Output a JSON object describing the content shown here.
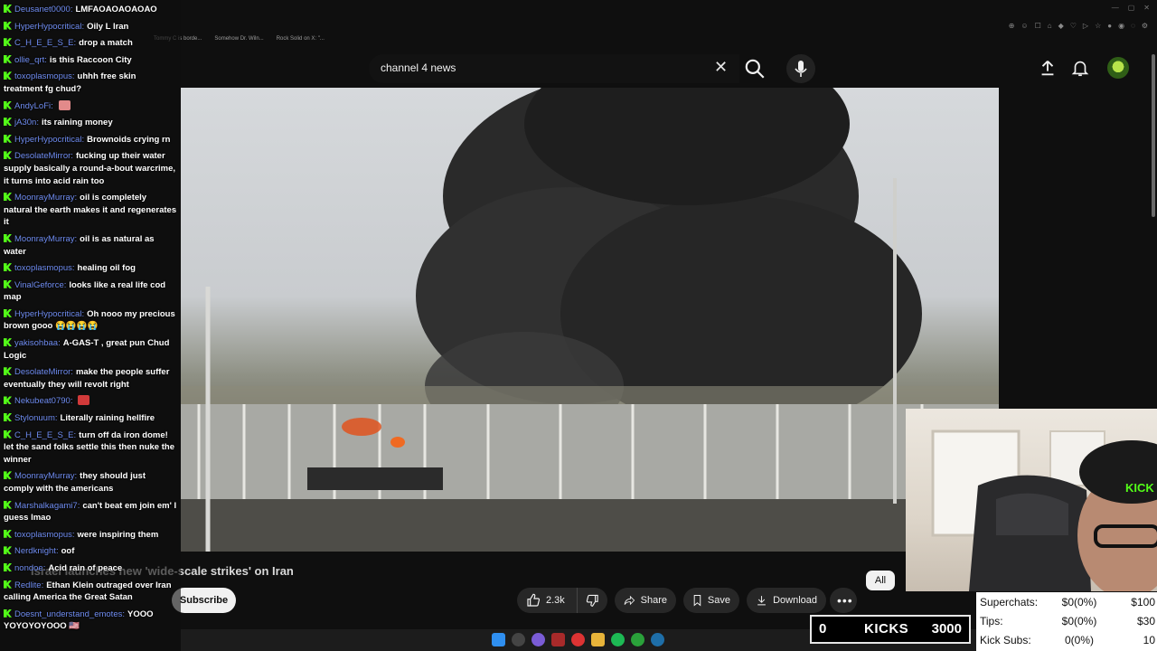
{
  "browser": {
    "tabs": [
      "Tommy C is borde...",
      "Somehow Dr. Wiln...",
      "Rock Solid on X: \"..."
    ]
  },
  "search": {
    "query": "channel 4 news"
  },
  "video": {
    "title": "Israel launches new 'wide-scale strikes' on Iran",
    "filter_chip": "All",
    "subscribe_label": "Subscribe",
    "likes": "2.3k",
    "share_label": "Share",
    "save_label": "Save",
    "download_label": "Download"
  },
  "chat": [
    {
      "user": "Deusanet0000",
      "text": "LMFAOAOAOAOAO"
    },
    {
      "user": "HyperHypocritical",
      "text": "Oily L Iran"
    },
    {
      "user": "C_H_E_E_S_E",
      "text": "drop a match"
    },
    {
      "user": "ollie_qrt",
      "text": "is this Raccoon City"
    },
    {
      "user": "toxoplasmopus",
      "text": "uhhh free skin treatment fg chud?"
    },
    {
      "user": "AndyLoFi",
      "text": "",
      "emote": "pink"
    },
    {
      "user": "jA30n",
      "text": "its raining money"
    },
    {
      "user": "HyperHypocritical",
      "text": "Brownoids crying rn"
    },
    {
      "user": "DesolateMirror",
      "text": "fucking up their water supply basically a round-a-bout warcrime, it turns into acid rain too"
    },
    {
      "user": "MoonrayMurray",
      "text": "oil is completely natural the earth makes it and regenerates it"
    },
    {
      "user": "MoonrayMurray",
      "text": "oil is as natural as water"
    },
    {
      "user": "toxoplasmopus",
      "text": "healing oil fog"
    },
    {
      "user": "VinalGeforce",
      "text": "looks like a real life cod map"
    },
    {
      "user": "HyperHypocritical",
      "text": "Oh nooo my precious brown gooo 😭😭😭😭"
    },
    {
      "user": "yakisohbaa",
      "text": "A-GAS-T , great pun Chud Logic"
    },
    {
      "user": "DesolateMirror",
      "text": "make the people suffer eventually they will revolt right"
    },
    {
      "user": "Nekubeat0790",
      "text": "",
      "emote": "red"
    },
    {
      "user": "Stylonuum",
      "text": "Literally raining hellfire"
    },
    {
      "user": "C_H_E_E_S_E",
      "text": "turn off da iron dome! let the sand folks settle this then nuke the winner"
    },
    {
      "user": "MoonrayMurray",
      "text": "they should just comply with the americans"
    },
    {
      "user": "Marshalkagami7",
      "text": "can't beat em join em' I guess lmao"
    },
    {
      "user": "toxoplasmopus",
      "text": "were inspiring them"
    },
    {
      "user": "Nerdknight",
      "text": "oof"
    },
    {
      "user": "nondoe",
      "text": "Acid rain of peace"
    },
    {
      "user": "Redlite",
      "text": "Ethan Klein outraged over Iran calling America the Great Satan"
    },
    {
      "user": "Doesnt_understand_emotes",
      "text": "YOOO YOYOYOYOOO 🇺🇸"
    }
  ],
  "donations": {
    "rows": [
      {
        "label": "Superchats:",
        "value": "$0(0%)",
        "goal": "$100"
      },
      {
        "label": "Tips:",
        "value": "$0(0%)",
        "goal": "$30"
      },
      {
        "label": "Kick Subs:",
        "value": "0(0%)",
        "goal": "10"
      }
    ]
  },
  "kicks_goal": {
    "current": "0",
    "label": "KICKS",
    "target": "3000"
  },
  "webcam": {
    "hat_text": "KICK"
  },
  "colors": {
    "kick_green": "#53fc18",
    "username": "#6f8cf0",
    "background": "#0f0f0f"
  }
}
